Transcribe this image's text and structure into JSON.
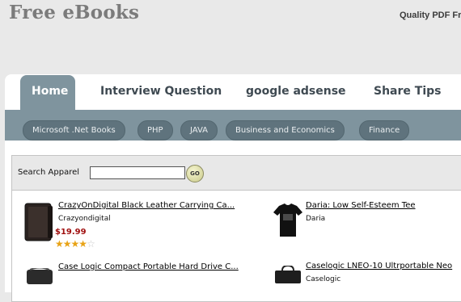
{
  "header": {
    "title": "Free eBooks",
    "tagline": "Quality PDF Fr"
  },
  "tabs": [
    {
      "label": "Home",
      "active": true
    },
    {
      "label": "Interview Question",
      "active": false
    },
    {
      "label": "google adsense",
      "active": false
    },
    {
      "label": "Share Tips",
      "active": false
    }
  ],
  "subnav": [
    {
      "label": "Microsoft .Net Books"
    },
    {
      "label": "PHP"
    },
    {
      "label": "JAVA"
    },
    {
      "label": "Business and Economics"
    },
    {
      "label": "Finance"
    }
  ],
  "search": {
    "label": "Search Apparel",
    "value": "",
    "button_label": "GO"
  },
  "products": [
    {
      "title": "CrazyOnDigital Black Leather Carrying Ca...",
      "brand": "Crazyondigital",
      "price": "$19.99",
      "rating": 4,
      "rating_max": 5
    },
    {
      "title": "Daria: Low Self-Esteem Tee",
      "brand": "Daria"
    },
    {
      "title": "Case Logic Compact Portable Hard Drive C...",
      "brand": ""
    },
    {
      "title": "Caselogic LNEO-10 Ultrportable Neo",
      "brand": "Caselogic"
    }
  ],
  "colors": {
    "nav_bar": "#7f949e",
    "pill": "#5f737d",
    "title_gray": "#7b7b7b",
    "price_red": "#a01010",
    "star_gold": "#e8a316"
  }
}
